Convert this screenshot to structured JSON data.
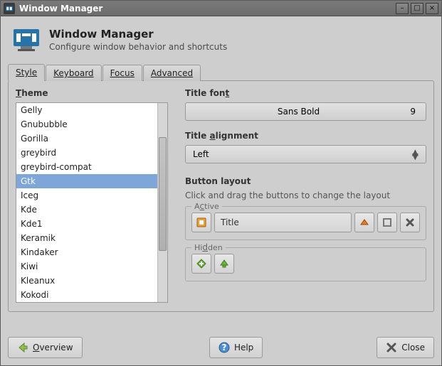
{
  "window": {
    "title": "Window Manager"
  },
  "header": {
    "title": "Window Manager",
    "subtitle": "Configure window behavior and shortcuts"
  },
  "tabs": {
    "style": "Style",
    "keyboard": "Keyboard",
    "focus": "Focus",
    "advanced": "Advanced"
  },
  "labels": {
    "theme": "Theme",
    "title_font": "Title font",
    "title_alignment": "Title alignment",
    "button_layout": "Button layout",
    "button_hint": "Click and drag the buttons to change the layout",
    "active": "Active",
    "hidden": "Hidden"
  },
  "theme_list": {
    "items": [
      "Gelly",
      "Gnububble",
      "Gorilla",
      "greybird",
      "greybird-compat",
      "Gtk",
      "Iceg",
      "Kde",
      "Kde1",
      "Keramik",
      "Kindaker",
      "Kiwi",
      "Kleanux",
      "Kokodi"
    ],
    "selected_index": 5
  },
  "title_font": {
    "name": "Sans Bold",
    "size": "9"
  },
  "alignment": {
    "value": "Left"
  },
  "active_titlebar": {
    "title": "Title"
  },
  "footer": {
    "overview": "Overview",
    "help": "Help",
    "close": "Close"
  }
}
